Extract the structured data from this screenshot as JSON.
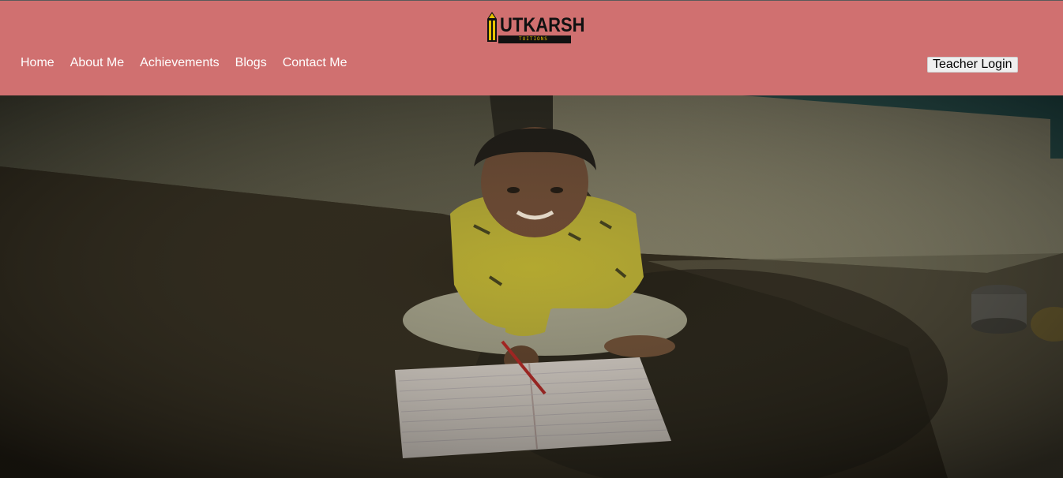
{
  "brand": {
    "name": "UTKARSH",
    "tagline": "TUITIONS"
  },
  "nav": {
    "items": [
      {
        "label": "Home"
      },
      {
        "label": "About Me"
      },
      {
        "label": "Achievements"
      },
      {
        "label": "Blogs"
      },
      {
        "label": "Contact Me"
      }
    ]
  },
  "actions": {
    "teacher_login": "Teacher Login"
  },
  "colors": {
    "header_bg": "#d07070",
    "nav_text": "#ffffff"
  },
  "hero": {
    "image_subject": "child sitting on floor writing in notebook"
  }
}
